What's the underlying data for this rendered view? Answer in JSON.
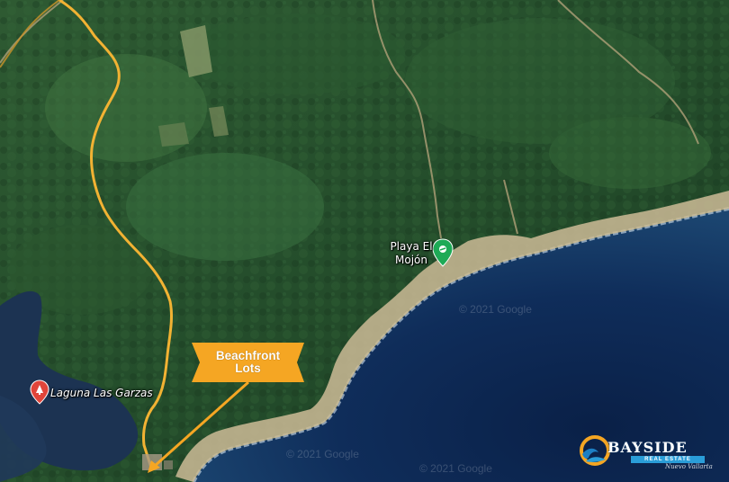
{
  "map": {
    "places": {
      "laguna": "Laguna Las Garzas",
      "playa_line1": "Playa El",
      "playa_line2": "Mojón"
    },
    "callout": {
      "line1": "Beachfront",
      "line2": "Lots",
      "color": "#f5a623"
    },
    "route_color": "#f2b233",
    "watermarks": [
      "© 2021 Google",
      "© 2021 Google",
      "© 2021 Google"
    ]
  },
  "logo": {
    "brand": "BAYSIDE",
    "tagline": "REAL ESTATE",
    "signature": "Nuevo Vallarta"
  }
}
